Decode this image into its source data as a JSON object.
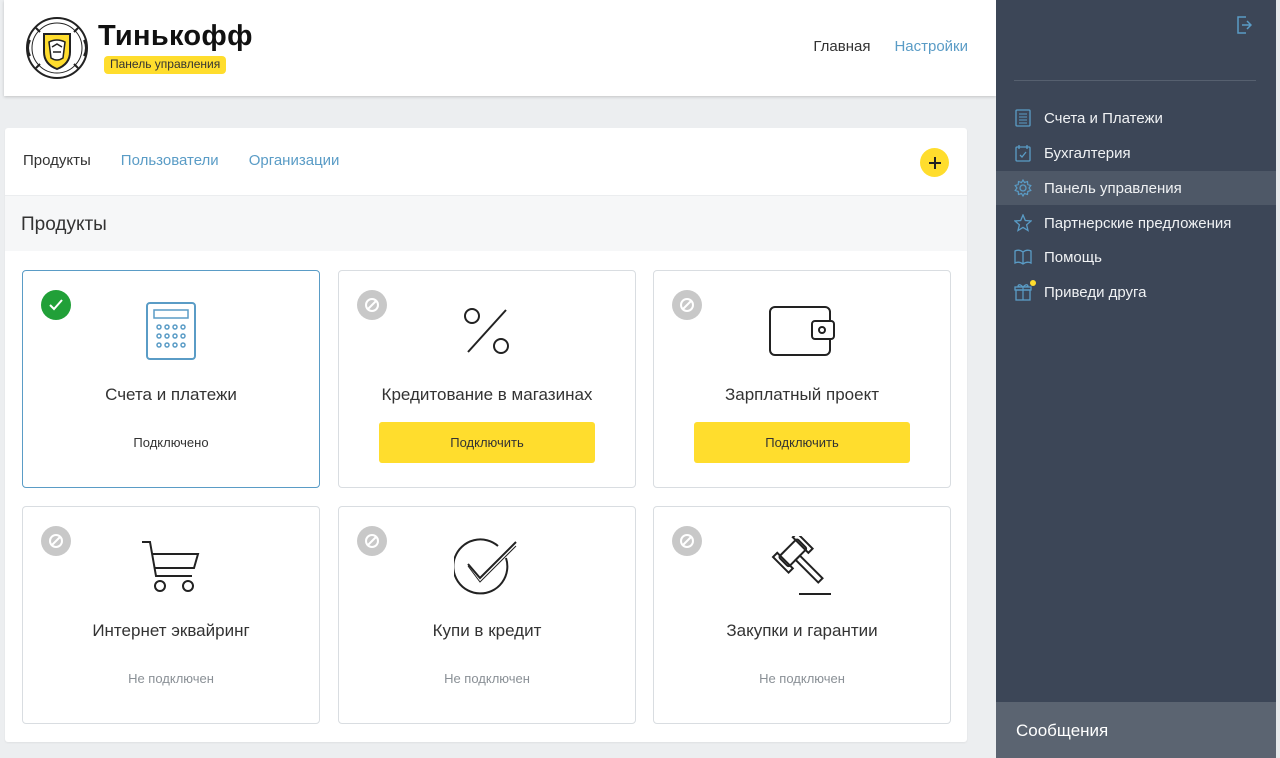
{
  "header": {
    "brand_name": "Тинькофф",
    "brand_badge": "Панель управления",
    "nav": [
      {
        "label": "Главная"
      },
      {
        "label": "Настройки"
      }
    ]
  },
  "panel": {
    "tabs": [
      {
        "label": "Продукты"
      },
      {
        "label": "Пользователи"
      },
      {
        "label": "Организации"
      }
    ],
    "add_icon": "plus-icon",
    "section_title": "Продукты"
  },
  "products": [
    {
      "title": "Счета и платежи",
      "status": "Подключено",
      "icon": "calculator-icon"
    },
    {
      "title": "Кредитование в магазинах",
      "button": "Подключить",
      "icon": "percent-icon"
    },
    {
      "title": "Зарплатный проект",
      "button": "Подключить",
      "icon": "wallet-icon"
    },
    {
      "title": "Интернет эквайринг",
      "status": "Не подключен",
      "icon": "cart-icon"
    },
    {
      "title": "Купи в кредит",
      "status": "Не подключен",
      "icon": "check-circle-icon"
    },
    {
      "title": "Закупки и гарантии",
      "status": "Не подключен",
      "icon": "gavel-icon"
    }
  ],
  "sidebar": {
    "items": [
      {
        "label": "Счета и Платежи",
        "icon": "accounts-icon"
      },
      {
        "label": "Бухгалтерия",
        "icon": "calendar-check-icon"
      },
      {
        "label": "Панель управления",
        "icon": "gear-icon"
      },
      {
        "label": "Партнерские предложения",
        "icon": "star-icon"
      },
      {
        "label": "Помощь",
        "icon": "book-icon"
      },
      {
        "label": "Приведи друга",
        "icon": "gift-icon"
      }
    ],
    "messages": "Сообщения"
  },
  "colors": {
    "accent_yellow": "#ffdd2d",
    "link_blue": "#5a9cc6",
    "sidebar_bg": "#3c4657",
    "success_green": "#21a038"
  }
}
